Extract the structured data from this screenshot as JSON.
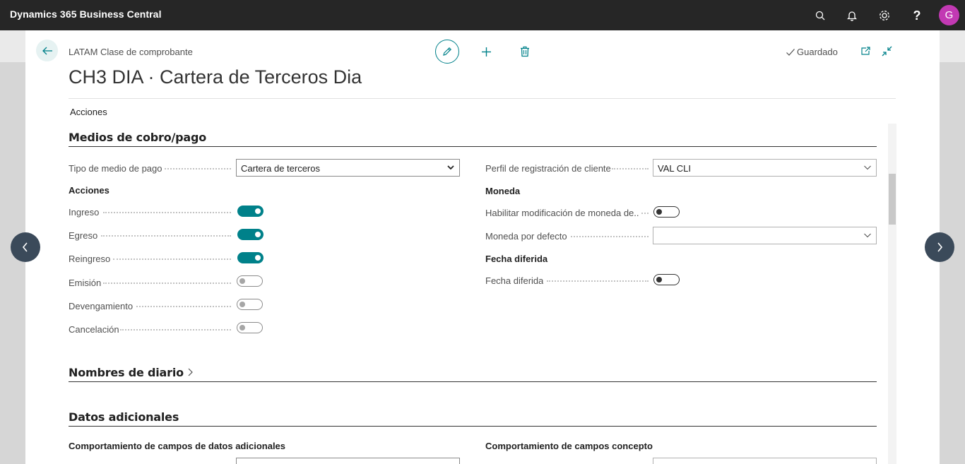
{
  "app": {
    "title": "Dynamics 365 Business Central",
    "avatar_initial": "G",
    "avatar_color": "#c239b3"
  },
  "header": {
    "breadcrumb": "LATAM Clase de comprobante",
    "title": "CH3 DIA · Cartera de Terceros Dia",
    "saved_label": "Guardado",
    "actions_label": "Acciones",
    "accent_color": "#00818a"
  },
  "sections": {
    "medios": {
      "title": "Medios de cobro/pago",
      "tipo_medio_label": "Tipo de medio de pago",
      "tipo_medio_value": "Cartera de terceros",
      "acciones_group": "Acciones",
      "toggles": [
        {
          "label": "Ingreso",
          "value": true
        },
        {
          "label": "Egreso",
          "value": true
        },
        {
          "label": "Reingreso",
          "value": true
        },
        {
          "label": "Emisión",
          "value": false
        },
        {
          "label": "Devengamiento",
          "value": false
        },
        {
          "label": "Cancelación",
          "value": false
        }
      ],
      "perfil_label": "Perfil de registración de cliente",
      "perfil_value": "VAL CLI",
      "moneda_group": "Moneda",
      "habilitar_label": "Habilitar modificación de moneda de...",
      "habilitar_value": false,
      "moneda_defecto_label": "Moneda por defecto",
      "moneda_defecto_value": "",
      "fecha_group": "Fecha diferida",
      "fecha_label": "Fecha diferida",
      "fecha_value": false
    },
    "nombres": {
      "title": "Nombres de diario"
    },
    "datos": {
      "title": "Datos adicionales",
      "left_group": "Comportamiento de campos de datos adicionales",
      "right_group": "Comportamiento de campos concepto"
    }
  }
}
